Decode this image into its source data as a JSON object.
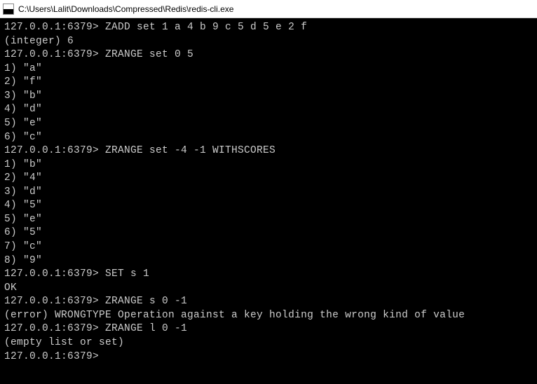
{
  "window": {
    "title": "C:\\Users\\Lalit\\Downloads\\Compressed\\Redis\\redis-cli.exe"
  },
  "terminal": {
    "lines": [
      "127.0.0.1:6379> ZADD set 1 a 4 b 9 c 5 d 5 e 2 f",
      "(integer) 6",
      "127.0.0.1:6379> ZRANGE set 0 5",
      "1) \"a\"",
      "2) \"f\"",
      "3) \"b\"",
      "4) \"d\"",
      "5) \"e\"",
      "6) \"c\"",
      "127.0.0.1:6379> ZRANGE set -4 -1 WITHSCORES",
      "1) \"b\"",
      "2) \"4\"",
      "3) \"d\"",
      "4) \"5\"",
      "5) \"e\"",
      "6) \"5\"",
      "7) \"c\"",
      "8) \"9\"",
      "127.0.0.1:6379> SET s 1",
      "OK",
      "127.0.0.1:6379> ZRANGE s 0 -1",
      "(error) WRONGTYPE Operation against a key holding the wrong kind of value",
      "127.0.0.1:6379> ZRANGE l 0 -1",
      "(empty list or set)",
      "127.0.0.1:6379>"
    ]
  }
}
